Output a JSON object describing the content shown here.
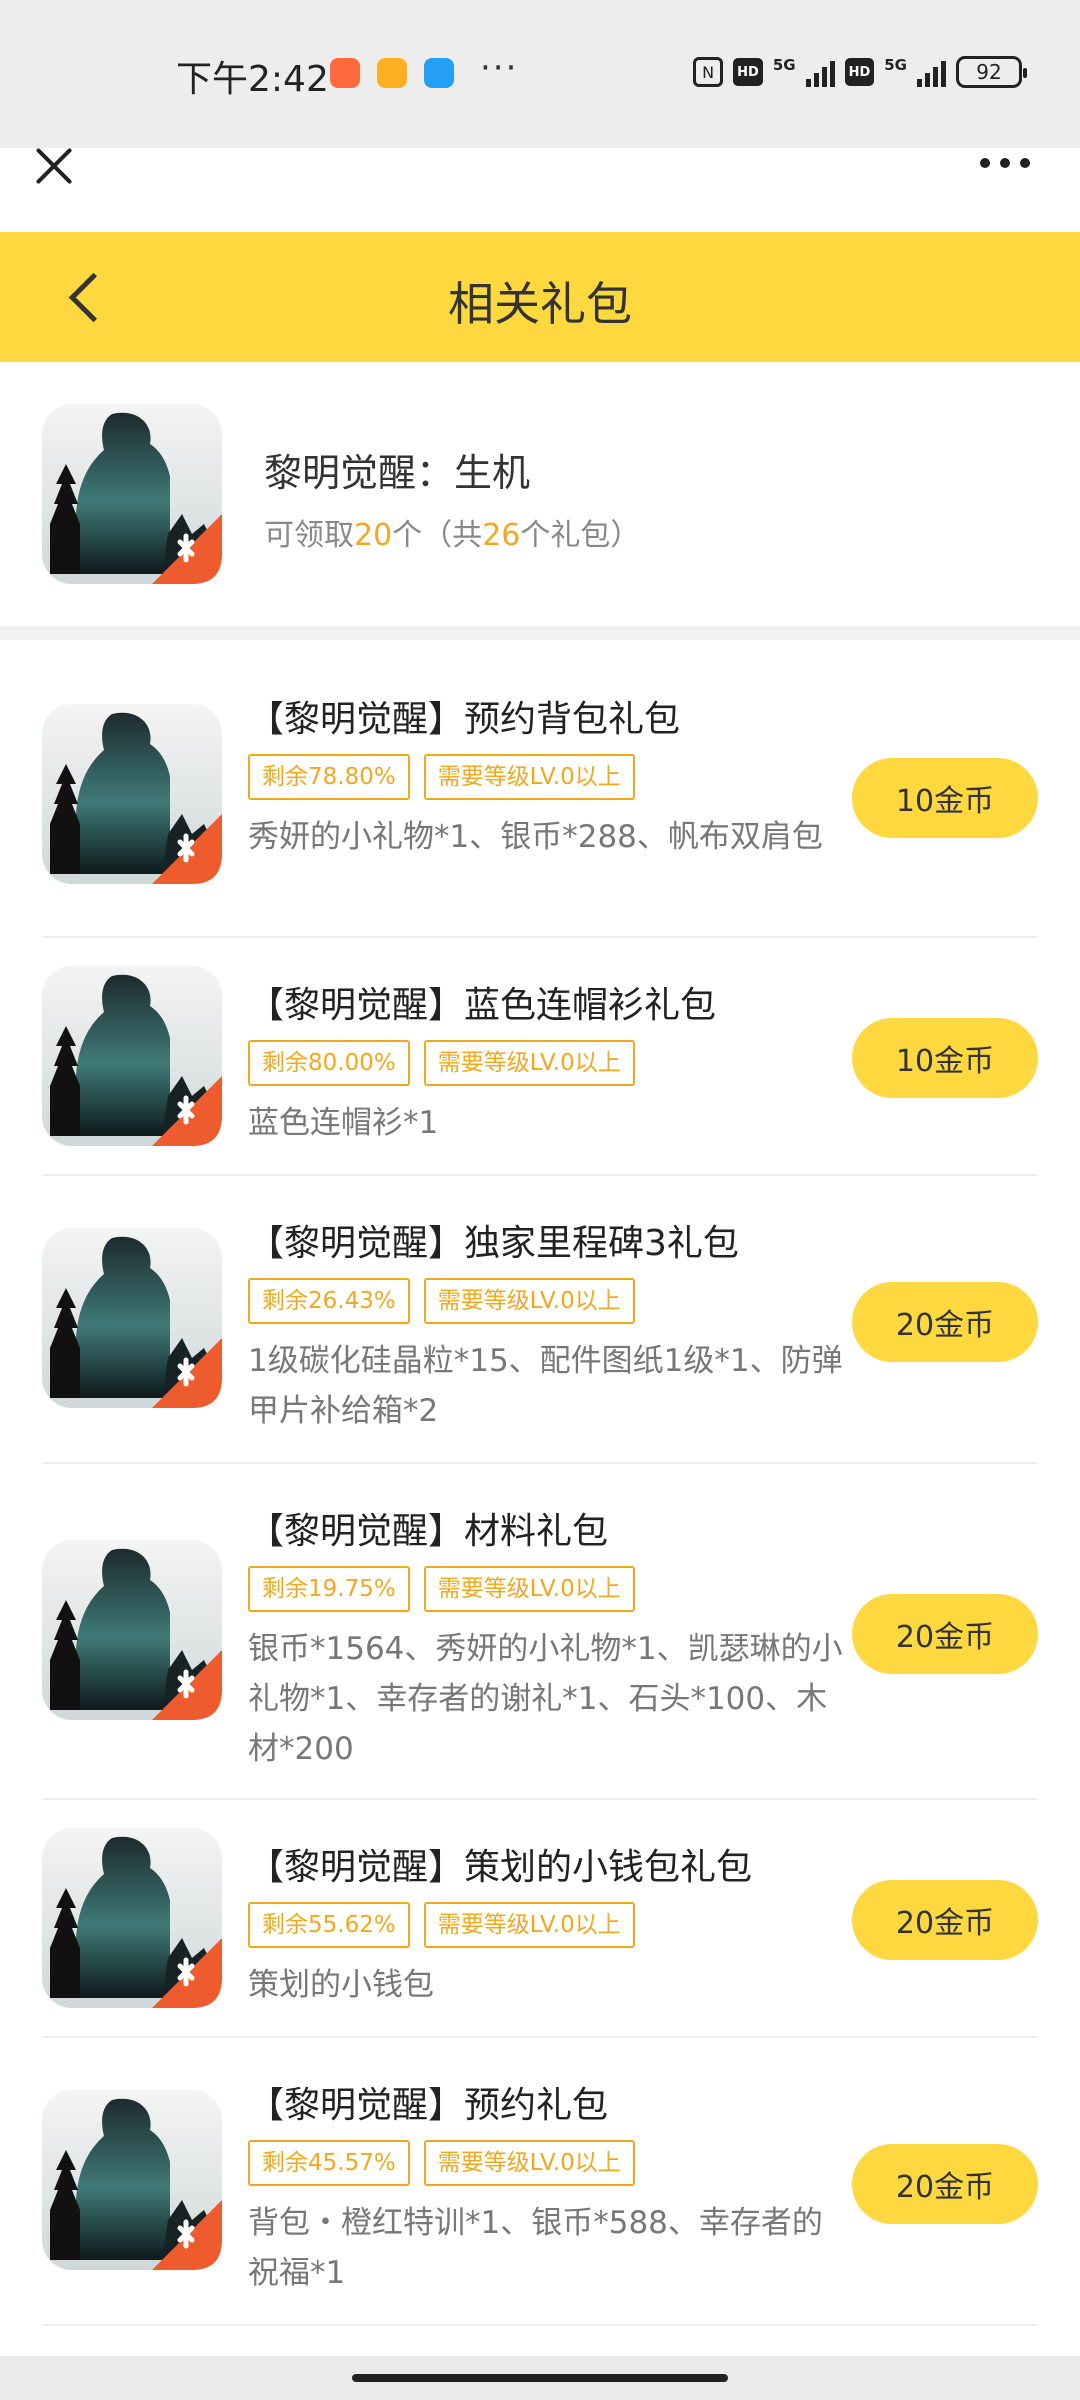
{
  "status_bar": {
    "time": "下午2:42",
    "more": "···",
    "network1": "5G",
    "network2": "5G",
    "hd1": "HD",
    "hd2": "HD",
    "battery": "92",
    "app_colors": [
      "#ff6a3d",
      "#ffb020",
      "#23a0f5"
    ]
  },
  "header": {
    "title": "相关礼包"
  },
  "game": {
    "name": "黎明觉醒：生机",
    "count_prefix": "可领取",
    "available": "20",
    "count_mid": "个（共",
    "total": "26",
    "count_suffix": "个礼包）"
  },
  "gifts": [
    {
      "title": "【黎明觉醒】预约背包礼包",
      "remaining": "剩余78.80%",
      "level": "需要等级LV.0以上",
      "desc": "秀妍的小礼物*1、银币*288、帆布双肩包",
      "price": "10金币"
    },
    {
      "title": "【黎明觉醒】蓝色连帽衫礼包",
      "remaining": "剩余80.00%",
      "level": "需要等级LV.0以上",
      "desc": "蓝色连帽衫*1",
      "price": "10金币"
    },
    {
      "title": "【黎明觉醒】独家里程碑3礼包",
      "remaining": "剩余26.43%",
      "level": "需要等级LV.0以上",
      "desc": "1级碳化硅晶粒*15、配件图纸1级*1、防弹甲片补给箱*2",
      "price": "20金币"
    },
    {
      "title": "【黎明觉醒】材料礼包",
      "remaining": "剩余19.75%",
      "level": "需要等级LV.0以上",
      "desc": "银币*1564、秀妍的小礼物*1、凯瑟琳的小礼物*1、幸存者的谢礼*1、石头*100、木材*200",
      "price": "20金币"
    },
    {
      "title": "【黎明觉醒】策划的小钱包礼包",
      "remaining": "剩余55.62%",
      "level": "需要等级LV.0以上",
      "desc": "策划的小钱包",
      "price": "20金币"
    },
    {
      "title": "【黎明觉醒】预约礼包",
      "remaining": "剩余45.57%",
      "level": "需要等级LV.0以上",
      "desc": "背包・橙红特训*1、银币*588、幸存者的祝福*1",
      "price": "20金币"
    }
  ]
}
